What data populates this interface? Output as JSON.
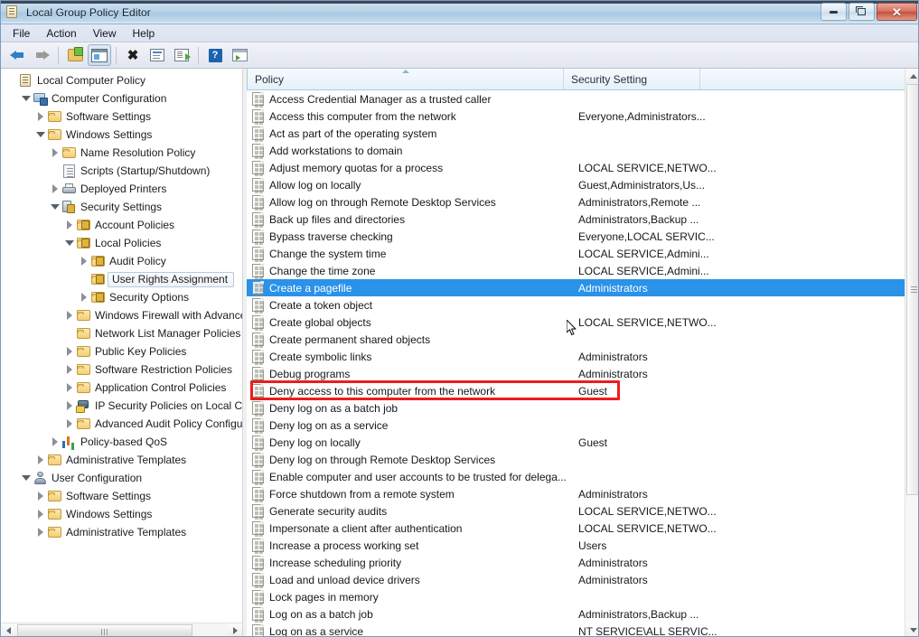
{
  "window": {
    "title": "Local Group Policy Editor",
    "icon": "policy-document-icon",
    "controls": {
      "minimize": "–",
      "maximize": "❐",
      "close": "✕"
    }
  },
  "menu": {
    "items": [
      "File",
      "Action",
      "View",
      "Help"
    ]
  },
  "toolbar": {
    "buttons": [
      {
        "name": "back",
        "icon": "back-arrow-icon"
      },
      {
        "name": "forward",
        "icon": "forward-arrow-icon"
      },
      {
        "name": "up-one-level",
        "icon": "folder-up-icon"
      },
      {
        "name": "show-hide-console-tree",
        "icon": "console-pane-icon",
        "pressed": true
      },
      {
        "name": "delete",
        "icon": "delete-x-icon"
      },
      {
        "name": "properties",
        "icon": "properties-icon"
      },
      {
        "name": "export-list",
        "icon": "export-list-icon"
      },
      {
        "name": "help",
        "icon": "help-question-icon"
      },
      {
        "name": "show-hide-action-pane",
        "icon": "action-pane-icon"
      }
    ]
  },
  "tree": {
    "nodes": [
      {
        "label": "Local Computer Policy",
        "indent": 0,
        "expander": "none",
        "icon": "policy-root-icon",
        "selected": false
      },
      {
        "label": "Computer Configuration",
        "indent": 1,
        "expander": "expanded",
        "icon": "computer-icon",
        "selected": false
      },
      {
        "label": "Software Settings",
        "indent": 2,
        "expander": "collapsed",
        "icon": "folder-icon",
        "selected": false
      },
      {
        "label": "Windows Settings",
        "indent": 2,
        "expander": "expanded",
        "icon": "folder-icon",
        "selected": false
      },
      {
        "label": "Name Resolution Policy",
        "indent": 3,
        "expander": "collapsed",
        "icon": "folder-icon",
        "selected": false
      },
      {
        "label": "Scripts (Startup/Shutdown)",
        "indent": 3,
        "expander": "none",
        "icon": "script-icon",
        "selected": false
      },
      {
        "label": "Deployed Printers",
        "indent": 3,
        "expander": "collapsed",
        "icon": "printer-icon",
        "selected": false
      },
      {
        "label": "Security Settings",
        "indent": 3,
        "expander": "expanded",
        "icon": "security-lock-icon",
        "selected": false
      },
      {
        "label": "Account Policies",
        "indent": 4,
        "expander": "collapsed",
        "icon": "folder-lock-icon",
        "selected": false
      },
      {
        "label": "Local Policies",
        "indent": 4,
        "expander": "expanded",
        "icon": "folder-lock-icon",
        "selected": false
      },
      {
        "label": "Audit Policy",
        "indent": 5,
        "expander": "collapsed",
        "icon": "folder-lock-icon",
        "selected": false
      },
      {
        "label": "User Rights Assignment",
        "indent": 5,
        "expander": "none",
        "icon": "folder-lock-icon",
        "selected": true
      },
      {
        "label": "Security Options",
        "indent": 5,
        "expander": "collapsed",
        "icon": "folder-lock-icon",
        "selected": false
      },
      {
        "label": "Windows Firewall with Advanced Security",
        "indent": 4,
        "expander": "collapsed",
        "icon": "folder-icon",
        "selected": false
      },
      {
        "label": "Network List Manager Policies",
        "indent": 4,
        "expander": "none",
        "icon": "folder-icon",
        "selected": false
      },
      {
        "label": "Public Key Policies",
        "indent": 4,
        "expander": "collapsed",
        "icon": "folder-icon",
        "selected": false
      },
      {
        "label": "Software Restriction Policies",
        "indent": 4,
        "expander": "collapsed",
        "icon": "folder-icon",
        "selected": false
      },
      {
        "label": "Application Control Policies",
        "indent": 4,
        "expander": "collapsed",
        "icon": "folder-icon",
        "selected": false
      },
      {
        "label": "IP Security Policies on Local Computer",
        "indent": 4,
        "expander": "collapsed",
        "icon": "ip-security-icon",
        "selected": false
      },
      {
        "label": "Advanced Audit Policy Configuration",
        "indent": 4,
        "expander": "collapsed",
        "icon": "folder-icon",
        "selected": false
      },
      {
        "label": "Policy-based QoS",
        "indent": 3,
        "expander": "collapsed",
        "icon": "qos-chart-icon",
        "selected": false
      },
      {
        "label": "Administrative Templates",
        "indent": 2,
        "expander": "collapsed",
        "icon": "folder-icon",
        "selected": false
      },
      {
        "label": "User Configuration",
        "indent": 1,
        "expander": "expanded",
        "icon": "user-icon",
        "selected": false
      },
      {
        "label": "Software Settings",
        "indent": 2,
        "expander": "collapsed",
        "icon": "folder-icon",
        "selected": false
      },
      {
        "label": "Windows Settings",
        "indent": 2,
        "expander": "collapsed",
        "icon": "folder-icon",
        "selected": false
      },
      {
        "label": "Administrative Templates",
        "indent": 2,
        "expander": "collapsed",
        "icon": "folder-icon",
        "selected": false
      }
    ]
  },
  "list": {
    "columns": [
      {
        "label": "Policy",
        "sorted": "ascending"
      },
      {
        "label": "Security Setting",
        "sorted": "none"
      },
      {
        "label": "",
        "sorted": "none"
      }
    ],
    "rows": [
      {
        "policy": "Access Credential Manager as a trusted caller",
        "setting": ""
      },
      {
        "policy": "Access this computer from the network",
        "setting": "Everyone,Administrators..."
      },
      {
        "policy": "Act as part of the operating system",
        "setting": ""
      },
      {
        "policy": "Add workstations to domain",
        "setting": ""
      },
      {
        "policy": "Adjust memory quotas for a process",
        "setting": "LOCAL SERVICE,NETWO..."
      },
      {
        "policy": "Allow log on locally",
        "setting": "Guest,Administrators,Us..."
      },
      {
        "policy": "Allow log on through Remote Desktop Services",
        "setting": "Administrators,Remote ..."
      },
      {
        "policy": "Back up files and directories",
        "setting": "Administrators,Backup ..."
      },
      {
        "policy": "Bypass traverse checking",
        "setting": "Everyone,LOCAL SERVIC..."
      },
      {
        "policy": "Change the system time",
        "setting": "LOCAL SERVICE,Admini..."
      },
      {
        "policy": "Change the time zone",
        "setting": "LOCAL SERVICE,Admini..."
      },
      {
        "policy": "Create a pagefile",
        "setting": "Administrators",
        "selected": true
      },
      {
        "policy": "Create a token object",
        "setting": ""
      },
      {
        "policy": "Create global objects",
        "setting": "LOCAL SERVICE,NETWO..."
      },
      {
        "policy": "Create permanent shared objects",
        "setting": ""
      },
      {
        "policy": "Create symbolic links",
        "setting": "Administrators"
      },
      {
        "policy": "Debug programs",
        "setting": "Administrators"
      },
      {
        "policy": "Deny access to this computer from the network",
        "setting": "Guest",
        "annotated": true
      },
      {
        "policy": "Deny log on as a batch job",
        "setting": ""
      },
      {
        "policy": "Deny log on as a service",
        "setting": ""
      },
      {
        "policy": "Deny log on locally",
        "setting": "Guest"
      },
      {
        "policy": "Deny log on through Remote Desktop Services",
        "setting": ""
      },
      {
        "policy": "Enable computer and user accounts to be trusted for delega...",
        "setting": ""
      },
      {
        "policy": "Force shutdown from a remote system",
        "setting": "Administrators"
      },
      {
        "policy": "Generate security audits",
        "setting": "LOCAL SERVICE,NETWO..."
      },
      {
        "policy": "Impersonate a client after authentication",
        "setting": "LOCAL SERVICE,NETWO..."
      },
      {
        "policy": "Increase a process working set",
        "setting": "Users"
      },
      {
        "policy": "Increase scheduling priority",
        "setting": "Administrators"
      },
      {
        "policy": "Load and unload device drivers",
        "setting": "Administrators"
      },
      {
        "policy": "Lock pages in memory",
        "setting": ""
      },
      {
        "policy": "Log on as a batch job",
        "setting": "Administrators,Backup ..."
      },
      {
        "policy": "Log on as a service",
        "setting": "NT SERVICE\\ALL SERVIC..."
      }
    ]
  },
  "annotation": {
    "color": "#ee1c1c",
    "target": "Deny access to this computer from the network"
  },
  "colors": {
    "selection": "#2a92e8",
    "title_bar": "#a8c8e2",
    "header": "#e4f0f8",
    "annotation": "#ee1c1c"
  }
}
